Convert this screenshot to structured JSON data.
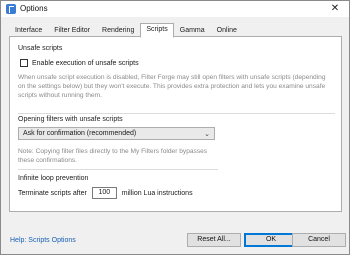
{
  "window": {
    "title": "Options",
    "close_glyph": "✕"
  },
  "tabs": [
    {
      "label": "Interface"
    },
    {
      "label": "Filter Editor"
    },
    {
      "label": "Rendering"
    },
    {
      "label": "Scripts",
      "active": true
    },
    {
      "label": "Gamma"
    },
    {
      "label": "Online"
    }
  ],
  "unsafe_scripts": {
    "title": "Unsafe scripts",
    "checkbox_label": "Enable execution of unsafe scripts",
    "checked": false,
    "description": "When unsafe script execution is disabled, Filter Forge may still open filters with unsafe scripts (depending on the settings below) but they won't execute. This provides extra protection and lets you examine unsafe scripts without running them."
  },
  "opening_filters": {
    "title": "Opening filters with unsafe scripts",
    "selected_option": "Ask for confirmation (recommended)",
    "note": "Note: Copying filter files directly to the My Filters folder bypasses these confirmations."
  },
  "infinite_loop": {
    "title": "Infinite loop prevention",
    "prefix": "Terminate scripts after",
    "value": "100",
    "suffix": "million Lua instructions"
  },
  "footer": {
    "help_link": "Help: Scripts Options",
    "reset_label": "Reset All...",
    "ok_label": "OK",
    "cancel_label": "Cancel"
  },
  "colors": {
    "link": "#1a5fb4",
    "default_button_border": "#0078d7",
    "icon": "#3a7bd5"
  },
  "icons": {
    "app": "filter-forge-app-icon",
    "close": "close-icon",
    "dropdown": "chevron-down-icon"
  }
}
